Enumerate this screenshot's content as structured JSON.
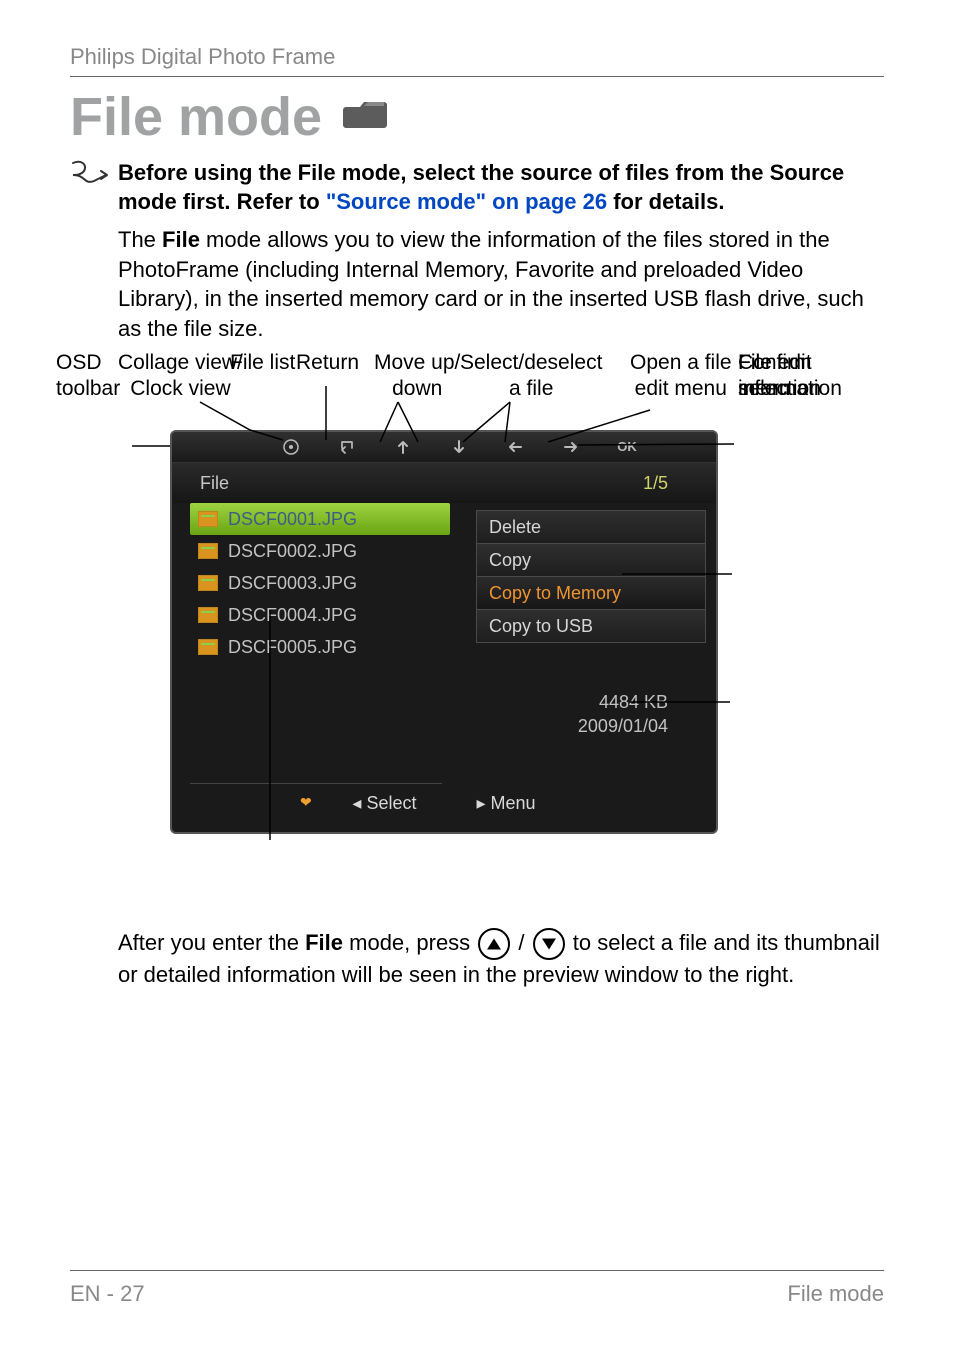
{
  "header": {
    "product": "Philips Digital Photo Frame"
  },
  "title": "File mode",
  "note": {
    "pre": "Before using the File mode, select the source of files from the Source mode first. Refer to ",
    "link": "\"Source mode\" on page 26",
    "post": " for details."
  },
  "intro": {
    "pre": "The ",
    "bold": "File",
    "post": " mode allows you to view the information of the files stored in the PhotoFrame (including Internal Memory, Favorite and preloaded Video Library), in the inserted memory card or in the inserted USB flash drive, such as the file size."
  },
  "diagram": {
    "labels": {
      "collage": "Collage view/\nClock view",
      "return": "Return",
      "move": "Move up/\ndown",
      "select_deselect": "Select/deselect\na file",
      "open_edit": "Open a file\nedit menu",
      "confirm": "Confirm\nselection",
      "osd": "OSD\ntoolbar",
      "file_edit": "File edit\nmenu",
      "file_info": "File\ninformation",
      "file_list": "File list"
    },
    "screenshot": {
      "title": "File",
      "page": "1/5",
      "files": [
        "DSCF0001.JPG",
        "DSCF0002.JPG",
        "DSCF0003.JPG",
        "DSCF0004.JPG",
        "DSCF0005.JPG"
      ],
      "edit_menu": [
        "Delete",
        "Copy",
        "Copy to Memory",
        "Copy to USB"
      ],
      "edit_selected_index": 2,
      "info": {
        "size": "4484 KB",
        "date": "2009/01/04"
      },
      "hints": {
        "left": "◂ Select",
        "right": "▸ Menu"
      },
      "ok": "OK"
    }
  },
  "after": {
    "pre": "After you enter the ",
    "bold": "File",
    "mid": " mode, press ",
    "sep": " / ",
    "post": " to select a file and its thumbnail or detailed information will be seen in the preview window to the right."
  },
  "footer": {
    "left": "EN - 27",
    "right": "File mode"
  }
}
